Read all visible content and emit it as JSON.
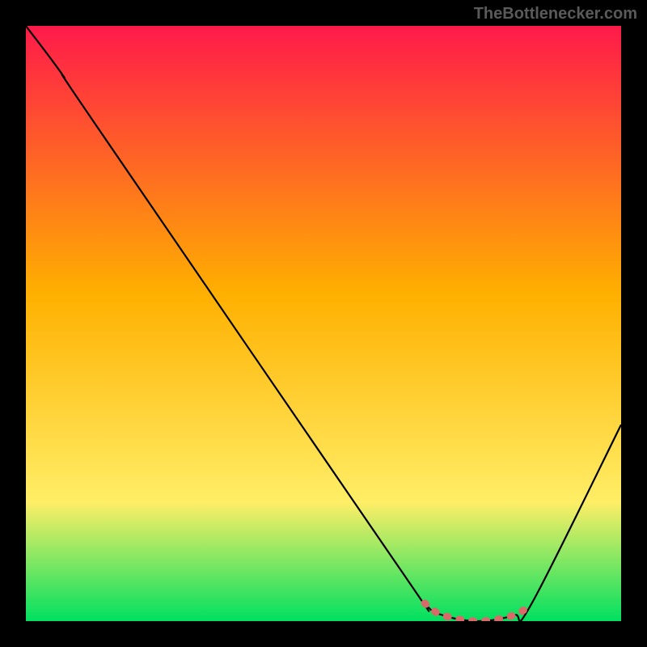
{
  "watermark": "TheBottlenecker.com",
  "chart_data": {
    "type": "line",
    "title": "",
    "xlabel": "",
    "ylabel": "",
    "xlim": [
      0,
      100
    ],
    "ylim": [
      0,
      100
    ],
    "background_gradient": {
      "top": "#ff1a4a",
      "upper_mid": "#ffb000",
      "lower_mid": "#ffee66",
      "bottom": "#00e060"
    },
    "series": [
      {
        "name": "bottleneck-curve",
        "color": "#000000",
        "points": [
          {
            "x": 0,
            "y": 100
          },
          {
            "x": 6,
            "y": 92
          },
          {
            "x": 12,
            "y": 83
          },
          {
            "x": 62,
            "y": 10
          },
          {
            "x": 67,
            "y": 3
          },
          {
            "x": 70,
            "y": 1
          },
          {
            "x": 76,
            "y": 0
          },
          {
            "x": 82,
            "y": 1
          },
          {
            "x": 85,
            "y": 3
          },
          {
            "x": 100,
            "y": 33
          }
        ]
      },
      {
        "name": "optimal-marker",
        "color": "#d96a6a",
        "thick": true,
        "points": [
          {
            "x": 67,
            "y": 3
          },
          {
            "x": 70,
            "y": 1
          },
          {
            "x": 76,
            "y": 0
          },
          {
            "x": 82,
            "y": 1
          },
          {
            "x": 85,
            "y": 3
          }
        ]
      }
    ]
  }
}
